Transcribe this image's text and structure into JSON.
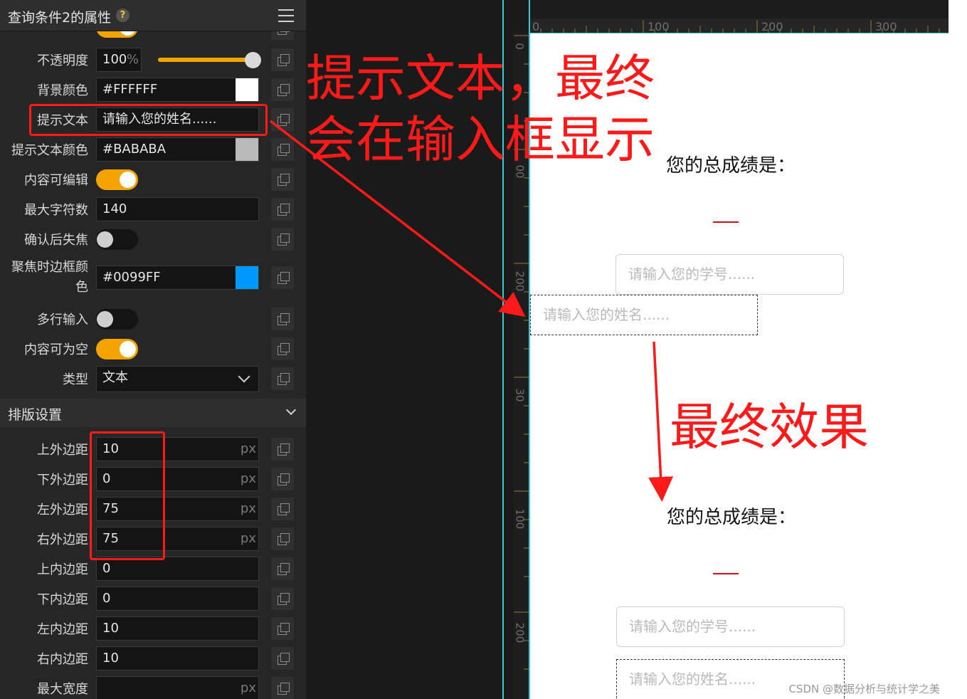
{
  "panel": {
    "title": "查询条件2的属性",
    "help_glyph": "?",
    "rows": [
      {
        "label": "不透明度",
        "value": "100",
        "unit": "%"
      },
      {
        "label": "背景颜色",
        "value": "#FFFFFF",
        "swatch": "#FFFFFF"
      },
      {
        "label": "提示文本",
        "value": "请输入您的姓名......"
      },
      {
        "label": "提示文本颜色",
        "value": "#BABABA",
        "swatch": "#BABABA"
      },
      {
        "label": "内容可编辑",
        "toggle": true
      },
      {
        "label": "最大字符数",
        "value": "140"
      },
      {
        "label": "确认后失焦",
        "toggle": false
      },
      {
        "label": "聚焦时边框颜色",
        "value": "#0099FF",
        "swatch": "#0099FF"
      },
      {
        "label": "多行输入",
        "toggle": false
      },
      {
        "label": "内容可为空",
        "toggle": true
      },
      {
        "label": "类型",
        "value": "文本"
      }
    ],
    "opacity_level": 1.0,
    "layout_section": {
      "title": "排版设置",
      "rows": [
        {
          "label": "上外边距",
          "value": "10",
          "unit": "px"
        },
        {
          "label": "下外边距",
          "value": "0",
          "unit": "px"
        },
        {
          "label": "左外边距",
          "value": "75",
          "unit": "px"
        },
        {
          "label": "右外边距",
          "value": "75",
          "unit": "px"
        },
        {
          "label": "上内边距",
          "value": "0"
        },
        {
          "label": "下内边距",
          "value": "0"
        },
        {
          "label": "左内边距",
          "value": "10"
        },
        {
          "label": "右内边距",
          "value": "10"
        },
        {
          "label": "最大宽度",
          "value": "",
          "unit": "px"
        }
      ]
    }
  },
  "ruler": {
    "top_ticks": [
      "0",
      "100",
      "200",
      "300"
    ],
    "left_ticks": [
      "0",
      "00",
      "200",
      "30",
      "100",
      "200"
    ]
  },
  "preview": {
    "top": {
      "score_label": "您的总成绩是：",
      "student_id_placeholder": "请输入您的学号......",
      "name_placeholder": "请输入您的姓名......"
    },
    "bottom": {
      "score_label": "您的总成绩是：",
      "student_id_placeholder": "请输入您的学号......",
      "name_placeholder": "请输入您的姓名......"
    }
  },
  "annotations": {
    "hint_line1": "提示文本，最终",
    "hint_line2": "会在输入框显示",
    "final_effect": "最终效果"
  },
  "watermark": "CSDN @数据分析与统计学之美",
  "colors": {
    "accent_orange": "#F5A300",
    "annotation_red": "#FF1A1A",
    "guide_cyan": "#3CCBD4",
    "focus_blue": "#0099FF"
  }
}
